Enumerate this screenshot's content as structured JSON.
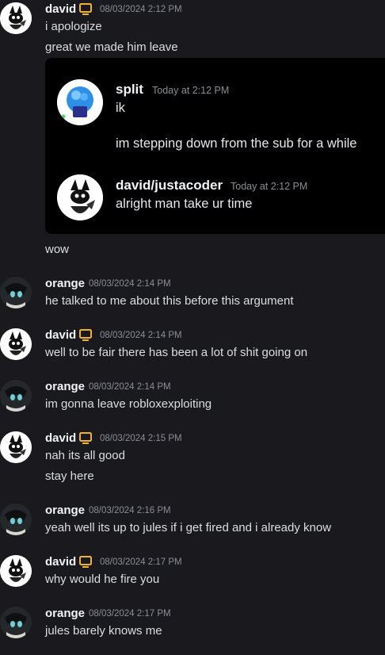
{
  "colors": {
    "background": "#1a1a1e",
    "embed_background": "#000000",
    "bot_tag": "#f0b232",
    "username": "#f2f3f5",
    "timestamp": "#8b8d94",
    "message_text": "#dbdee1"
  },
  "messages": [
    {
      "author": "david",
      "timestamp": "08/03/2024 2:12 PM",
      "icon": "monitor-icon",
      "lines": [
        "i apologize",
        "great we made him leave"
      ]
    },
    {
      "author": "",
      "timestamp": "",
      "lines": [
        "wow"
      ]
    },
    {
      "author": "orange",
      "timestamp": "08/03/2024 2:14 PM",
      "lines": [
        "he talked to me about this before this argument"
      ]
    },
    {
      "author": "david",
      "timestamp": "08/03/2024 2:14 PM",
      "icon": "monitor-icon",
      "lines": [
        "well to be fair there has been a lot of shit going on"
      ]
    },
    {
      "author": "orange",
      "timestamp": "08/03/2024 2:14 PM",
      "lines": [
        "im gonna leave robloxexploiting"
      ]
    },
    {
      "author": "david",
      "timestamp": "08/03/2024 2:15 PM",
      "icon": "monitor-icon",
      "lines": [
        "nah its all good",
        "stay here"
      ]
    },
    {
      "author": "orange",
      "timestamp": "08/03/2024 2:16 PM",
      "lines": [
        "yeah well its up to jules if i get fired and i already know"
      ]
    },
    {
      "author": "david",
      "timestamp": "08/03/2024 2:17 PM",
      "icon": "monitor-icon",
      "lines": [
        "why would he fire you"
      ]
    },
    {
      "author": "orange",
      "timestamp": "08/03/2024 2:17 PM",
      "lines": [
        "jules barely knows me"
      ]
    }
  ],
  "embed": {
    "messages": [
      {
        "author": "split",
        "timestamp": "Today at 2:12 PM",
        "lines": [
          "ik",
          "im stepping down from the sub for a while"
        ]
      },
      {
        "author": "david/justacoder",
        "timestamp": "Today at 2:12 PM",
        "lines": [
          "alright man take ur time"
        ]
      }
    ]
  }
}
